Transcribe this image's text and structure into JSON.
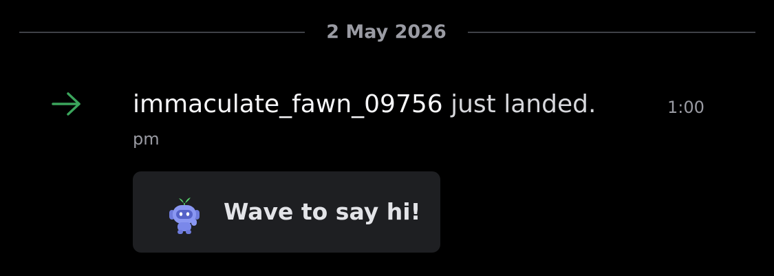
{
  "divider": {
    "date": "2 May 2026"
  },
  "message": {
    "username": "immaculate_fawn_09756",
    "text": "just landed.",
    "time_part1": "1:00",
    "time_part2": "pm",
    "icon": "join-arrow-icon",
    "icon_color": "#3ba55c"
  },
  "wave_button": {
    "label": "Wave to say hi!",
    "icon": "wumpus-icon"
  }
}
